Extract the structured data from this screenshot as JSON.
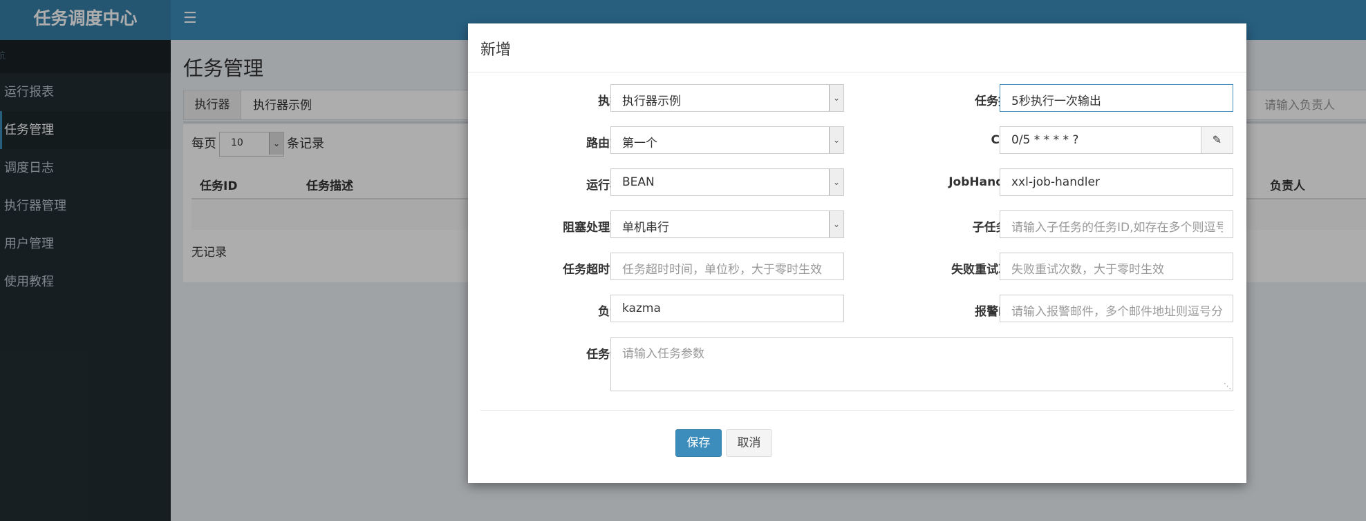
{
  "app": {
    "title": "任务调度中心"
  },
  "sidebar": {
    "header": "导航",
    "items": [
      {
        "label": "运行报表"
      },
      {
        "label": "任务管理",
        "active": true
      },
      {
        "label": "调度日志"
      },
      {
        "label": "执行器管理"
      },
      {
        "label": "用户管理"
      },
      {
        "label": "使用教程"
      }
    ]
  },
  "page": {
    "title": "任务管理",
    "filter": {
      "label": "执行器",
      "value": "执行器示例",
      "author_placeholder": "请输入负责人"
    },
    "table": {
      "perpage_prefix": "每页",
      "perpage_value": "10",
      "perpage_suffix": "条记录",
      "headers": [
        "任务ID",
        "任务描述",
        "负责人"
      ],
      "empty_text": "无记录"
    }
  },
  "modal": {
    "title": "新增",
    "fields": {
      "executor": {
        "label": "执行器",
        "value": "执行器示例"
      },
      "desc": {
        "label": "任务描述",
        "value": "5秒执行一次输出"
      },
      "route": {
        "label": "路由策略",
        "value": "第一个"
      },
      "cron": {
        "label": "Cron",
        "value": "0/5 * * * * ?"
      },
      "glue": {
        "label": "运行模式",
        "value": "BEAN"
      },
      "handler": {
        "label": "JobHandler",
        "value": "xxl-job-handler"
      },
      "block": {
        "label": "阻塞处理策略",
        "value": "单机串行"
      },
      "child": {
        "label": "子任务ID*",
        "placeholder": "请输入子任务的任务ID,如存在多个则逗号分隔"
      },
      "timeout": {
        "label": "任务超时时间*",
        "placeholder": "任务超时时间，单位秒，大于零时生效"
      },
      "retry": {
        "label": "失败重试次数*",
        "placeholder": "失败重试次数，大于零时生效"
      },
      "author": {
        "label": "负责人",
        "value": "kazma"
      },
      "alarm": {
        "label": "报警邮件*",
        "placeholder": "请输入报警邮件，多个邮件地址则逗号分隔"
      },
      "param": {
        "label": "任务参数*",
        "placeholder": "请输入任务参数"
      }
    },
    "save_label": "保存",
    "cancel_label": "取消"
  },
  "colors": {
    "primary": "#3c8dbc",
    "header_logo": "#367fa9",
    "sidebar": "#222d32",
    "required": "#dd4b39"
  },
  "icons": {
    "menu": "hamburger-icon",
    "cron_edit": "edit-icon",
    "dropdown": "chevron-down-icon"
  }
}
